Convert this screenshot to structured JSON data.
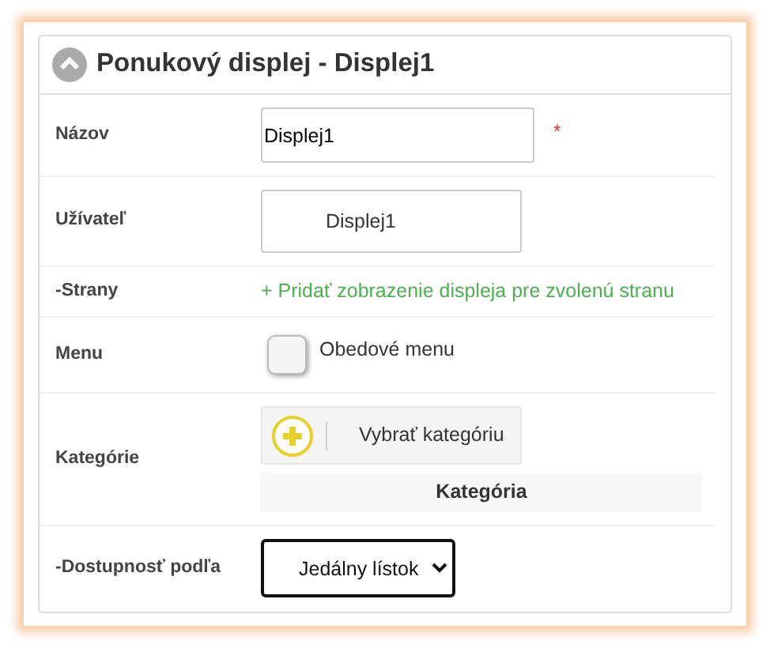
{
  "panel": {
    "title": "Ponukový displej - Displej1",
    "expanded": true
  },
  "rows": [
    {
      "kind": "input",
      "label": "Názov",
      "value": "Displej1",
      "required_mark": "*"
    },
    {
      "kind": "user",
      "label": "Užívateľ",
      "value": "Displej1"
    },
    {
      "kind": "link",
      "label": "-Strany",
      "text": "+ Pridať zobrazenie displeja pre zvolenú stranu"
    },
    {
      "kind": "checkbox",
      "label": "Menu",
      "text": "Obedové menu",
      "checked": false
    },
    {
      "kind": "category",
      "label": "Kategórie",
      "button": "Vybrať kategóriu",
      "column": "Kategória"
    },
    {
      "kind": "select",
      "label": "-Dostupnosť podľa",
      "value": "Jedálny lístok"
    }
  ]
}
